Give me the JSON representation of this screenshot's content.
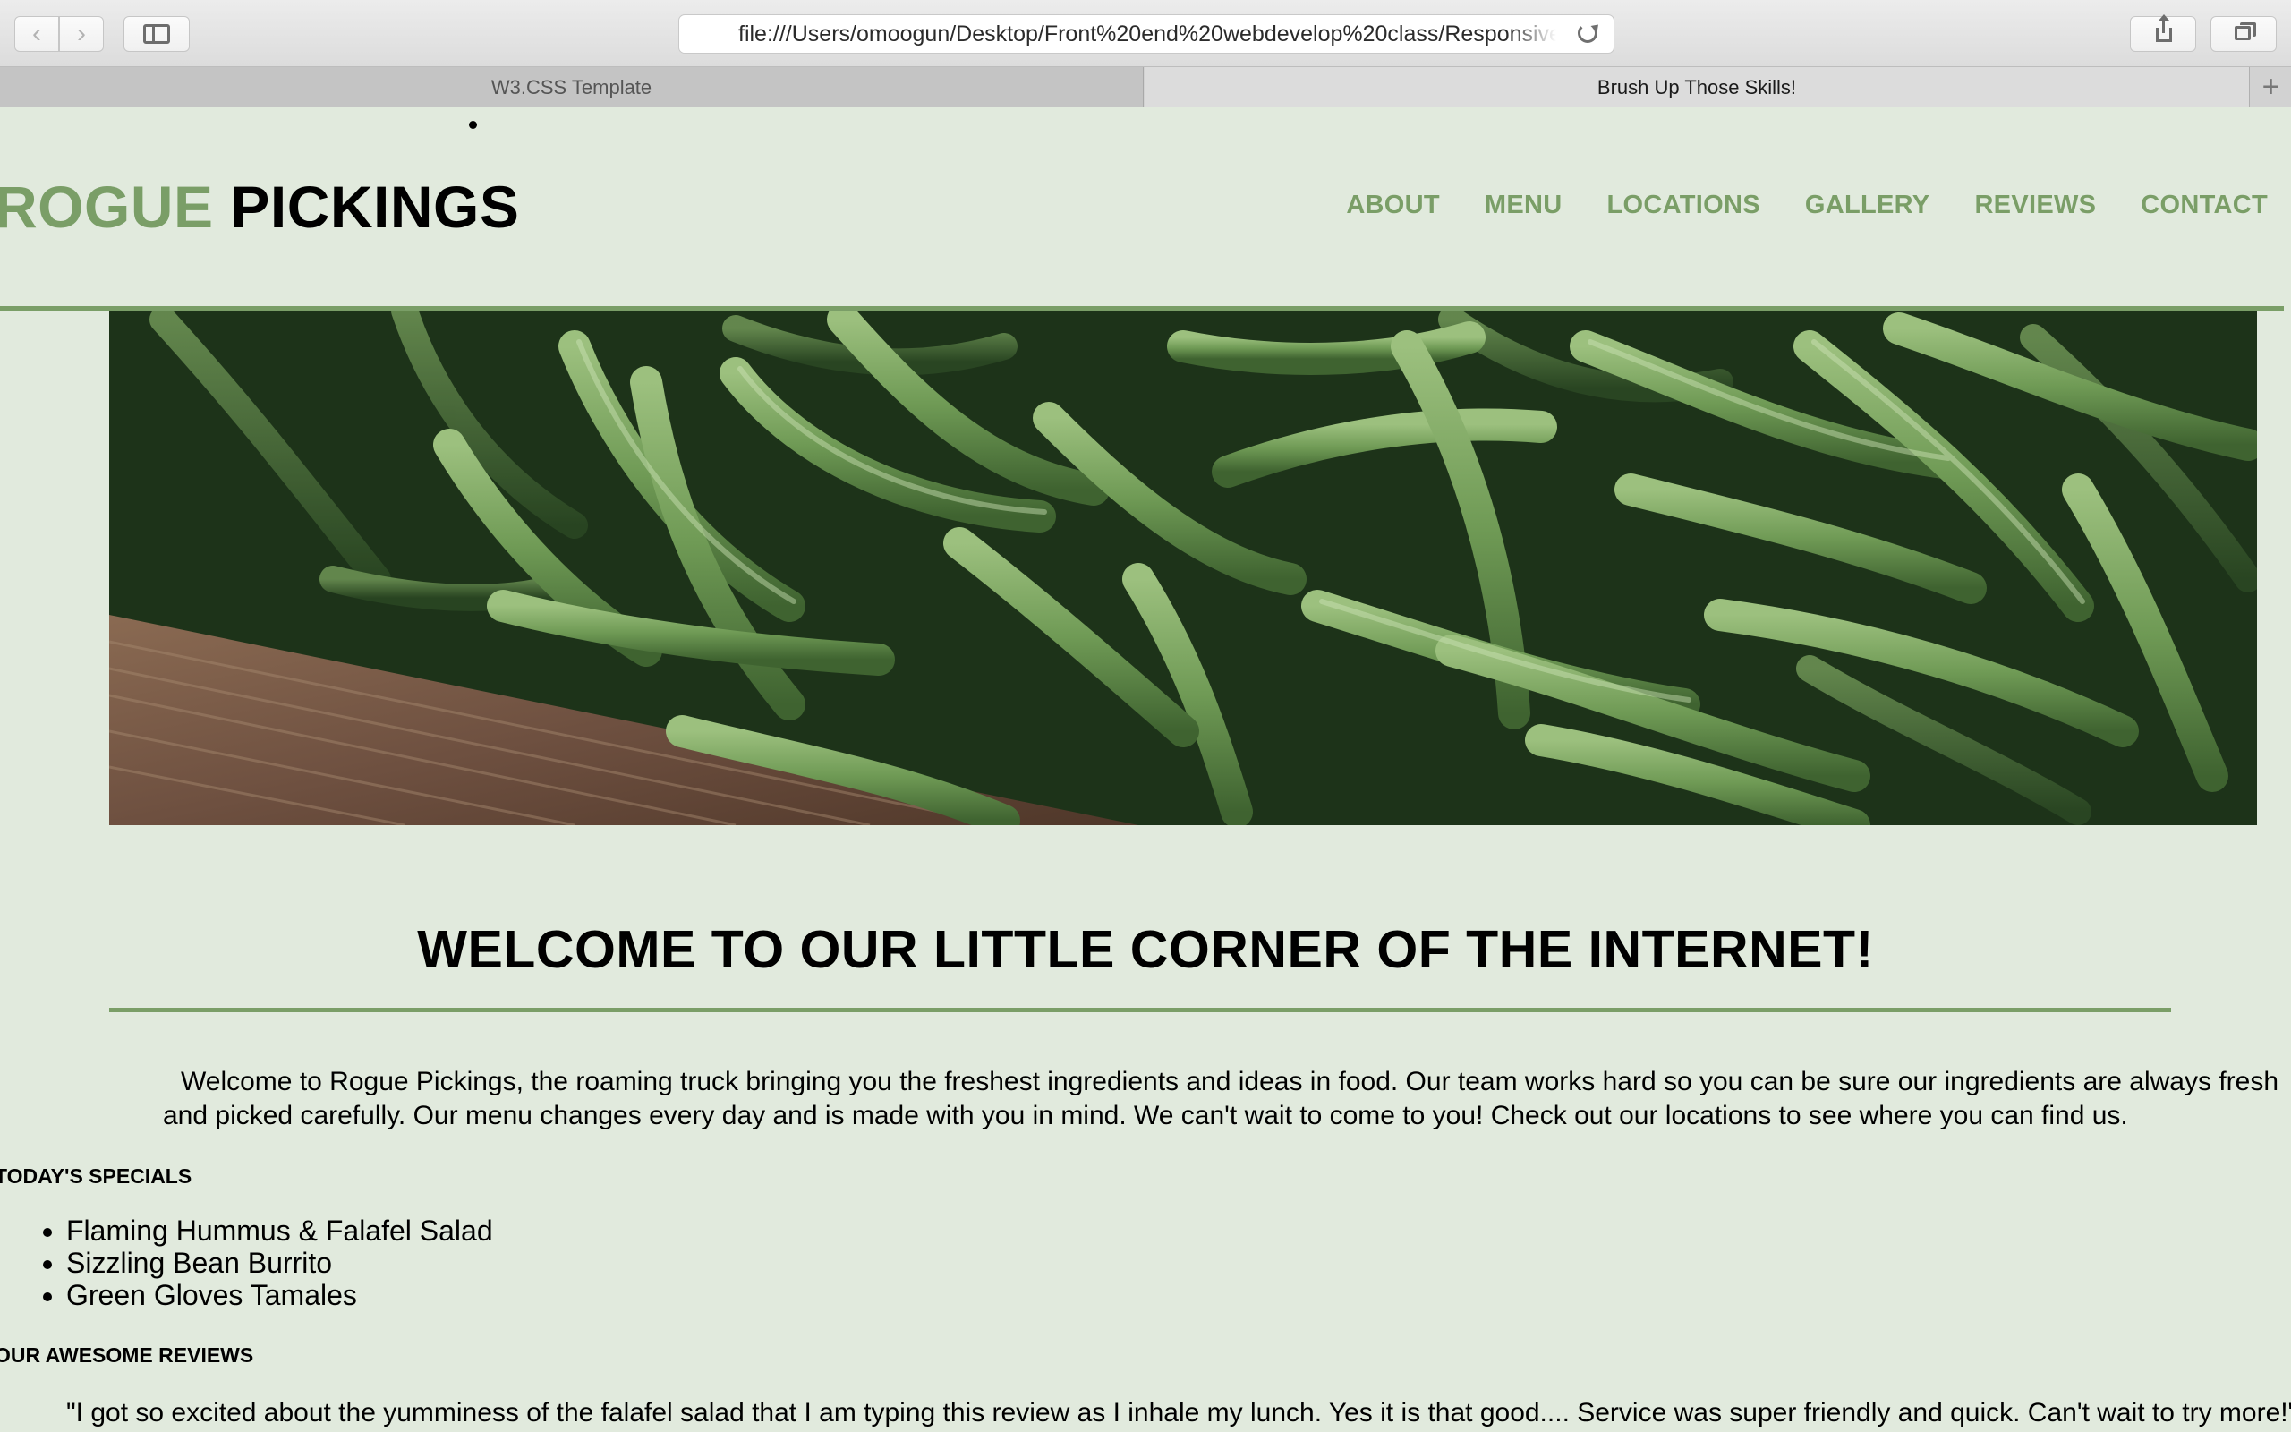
{
  "browser": {
    "back_icon": "chevron-left",
    "forward_icon": "chevron-right",
    "url": "file:///Users/omoogun/Desktop/Front%20end%20webdevelop%20class/Responsive",
    "tabs": [
      {
        "title": "W3.CSS Template",
        "active": false
      },
      {
        "title": "Brush Up Those Skills!",
        "active": true
      }
    ],
    "new_tab_label": "+"
  },
  "site": {
    "brand_part1": "ROGUE",
    "brand_part2": "PICKINGS",
    "nav": [
      "ABOUT",
      "MENU",
      "LOCATIONS",
      "GALLERY",
      "REVIEWS",
      "CONTACT"
    ],
    "accent_color": "#7a9e67",
    "background_color": "#e1eadd"
  },
  "hero": {
    "image_subject": "green beans in a wooden crate"
  },
  "main": {
    "title": "WELCOME TO OUR LITTLE CORNER OF THE INTERNET!",
    "intro": "Welcome to Rogue Pickings, the roaming truck bringing you the freshest ingredients and ideas in food. Our team works hard so you can be sure our ingredients are always fresh and picked carefully. Our menu changes every day and is made with you in mind. We can't wait to come to you! Check out our locations to see where you can find us.",
    "specials_heading": "TODAY'S SPECIALS",
    "specials": [
      "Flaming Hummus & Falafel Salad",
      "Sizzling Bean Burrito",
      "Green Gloves Tamales"
    ],
    "reviews_heading": "OUR AWESOME REVIEWS",
    "review": "\"I got so excited about the yumminess of the falafel salad that I am typing this review as I inhale my lunch. Yes it is that good.... Service was super friendly and quick. Can't wait to try more!\""
  }
}
